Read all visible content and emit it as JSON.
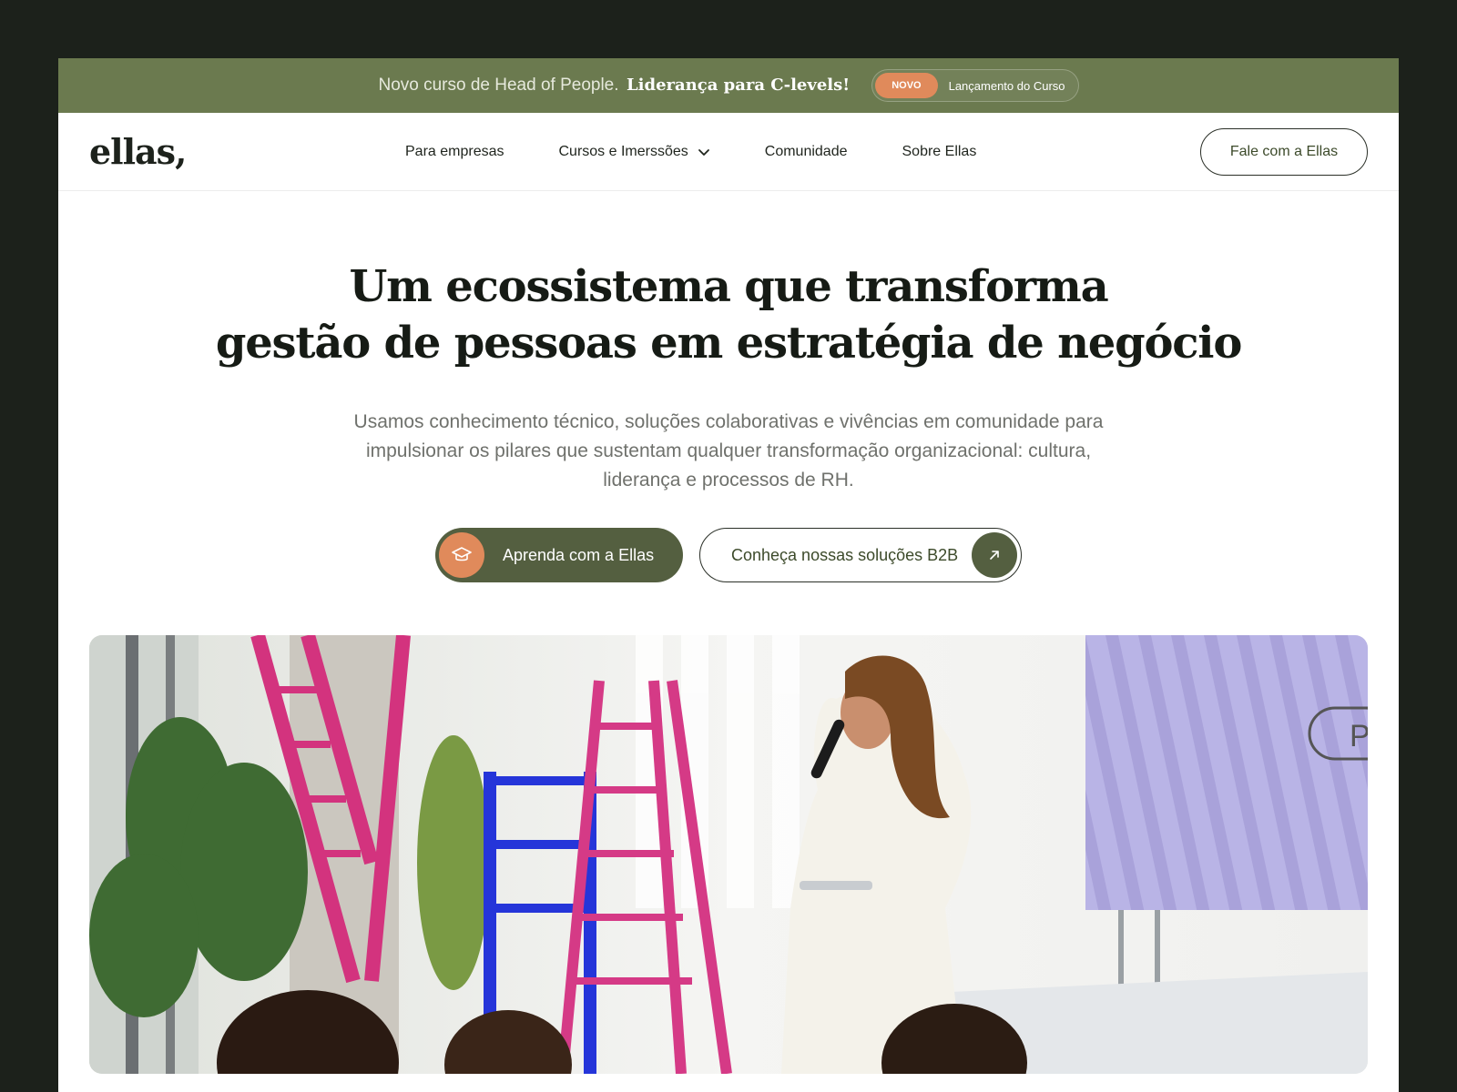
{
  "colors": {
    "page_bg": "#1c211b",
    "announcement_bg": "#6b7a4f",
    "accent_orange": "#e08a5b",
    "primary_green": "#545f40",
    "text_dark": "#161b15"
  },
  "announcement": {
    "text": "Novo curso de Head of People.",
    "highlight": "Liderança para C-levels!",
    "badge": "NOVO",
    "pill_label": "Lançamento do Curso"
  },
  "nav": {
    "logo": "ellas,",
    "items": [
      {
        "label": "Para empresas"
      },
      {
        "label": "Cursos e Imerssões",
        "icon": "chevron-down-icon"
      },
      {
        "label": "Comunidade"
      },
      {
        "label": "Sobre Ellas"
      }
    ],
    "cta": "Fale com a Ellas"
  },
  "hero": {
    "headline_line1": "Um ecossistema que transforma",
    "headline_line2": "gestão de pessoas em estratégia de negócio",
    "subtitle": "Usamos conhecimento técnico, soluções colaborativas e vivências em comunidade para impulsionar os pilares que sustentam qualquer transformação organizacional: cultura, liderança e processos de RH.",
    "primary_cta": {
      "label": "Aprenda com a Ellas",
      "icon": "graduation-cap-icon"
    },
    "secondary_cta": {
      "label": "Conheça nossas soluções B2B",
      "icon": "arrow-up-right-icon"
    }
  },
  "photo": {
    "screen_fragment": "P"
  }
}
